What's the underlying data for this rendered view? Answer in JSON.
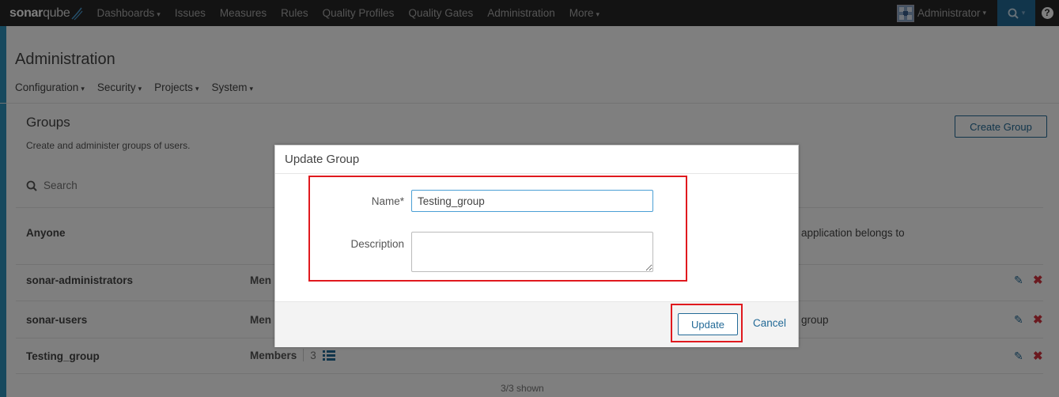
{
  "topnav": {
    "logo_bold": "sonar",
    "logo_light": "qube",
    "items": [
      {
        "label": "Dashboards",
        "has_caret": true
      },
      {
        "label": "Issues",
        "has_caret": false
      },
      {
        "label": "Measures",
        "has_caret": false
      },
      {
        "label": "Rules",
        "has_caret": false
      },
      {
        "label": "Quality Profiles",
        "has_caret": false
      },
      {
        "label": "Quality Gates",
        "has_caret": false
      },
      {
        "label": "Administration",
        "has_caret": false
      },
      {
        "label": "More",
        "has_caret": true
      }
    ],
    "user": "Administrator",
    "caret": "▾"
  },
  "page": {
    "title": "Administration",
    "subnav": [
      "Configuration",
      "Security",
      "Projects",
      "System"
    ]
  },
  "groups": {
    "title": "Groups",
    "subtitle": "Create and administer groups of users.",
    "create_label": "Create Group",
    "search_placeholder": "Search",
    "rows": [
      {
        "name": "Anyone",
        "members": "",
        "count": "",
        "description": "application belongs to"
      },
      {
        "name": "sonar-administrators",
        "members": "Men",
        "count": "",
        "description": ""
      },
      {
        "name": "sonar-users",
        "members": "Men",
        "count": "",
        "description": "group"
      },
      {
        "name": "Testing_group",
        "members": "Members",
        "count": "3",
        "description": ""
      }
    ],
    "shown": "3/3 shown"
  },
  "modal": {
    "title": "Update Group",
    "name_label": "Name*",
    "name_value": "Testing_group",
    "description_label": "Description",
    "description_value": "",
    "update_label": "Update",
    "cancel_label": "Cancel"
  },
  "colors": {
    "accent": "#236a97",
    "topnav_bg": "#262626",
    "danger": "#d4333f",
    "highlight": "#e0191e"
  }
}
